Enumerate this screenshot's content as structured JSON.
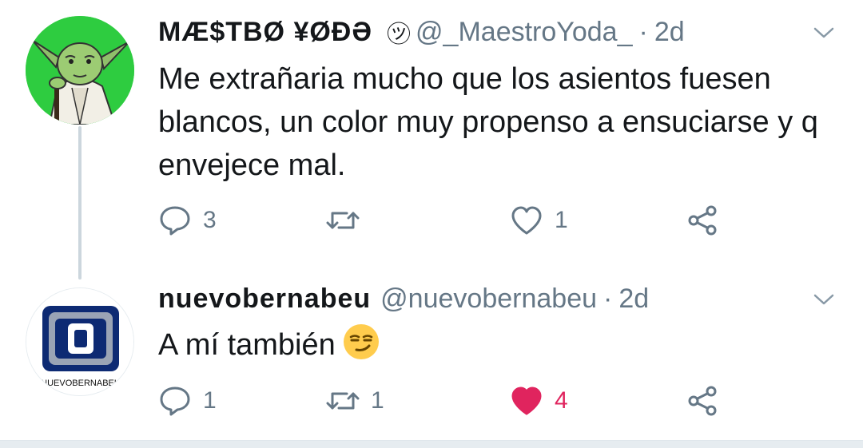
{
  "tweets": [
    {
      "display_name": "ΜÆ$TBØ ¥ØÐƏ",
      "handle": "@_MaestroYoda_",
      "separator": "·",
      "time": "2d",
      "text": "Me extrañaria mucho que los asientos fuesen blancos, un color muy propenso a ensuciarse y q envejece mal.",
      "avatar_icon": "yoda-avatar-icon",
      "actions": {
        "replies": "3",
        "retweets": "",
        "likes": "1",
        "liked": false
      }
    },
    {
      "display_name": "nuevobernabeu",
      "handle": "@nuevobernabeu",
      "separator": "·",
      "time": "2d",
      "text": "A mí también",
      "emoji": "smirk-emoji",
      "avatar_icon": "nuevobernabeu-logo-icon",
      "avatar_caption": "NUEVOBERNABEU",
      "actions": {
        "replies": "1",
        "retweets": "1",
        "likes": "4",
        "liked": true
      }
    }
  ],
  "colors": {
    "text": "#14171a",
    "muted": "#657786",
    "like": "#e0245e",
    "thread_line": "#ccd6dd"
  }
}
